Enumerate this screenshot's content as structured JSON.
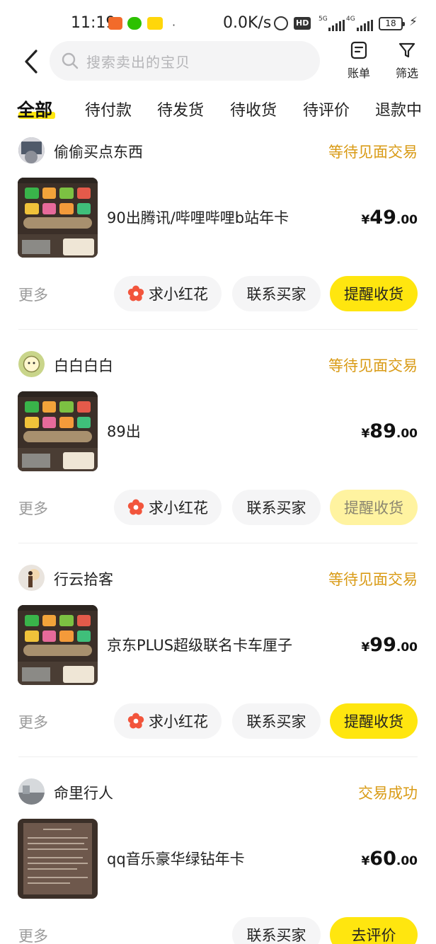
{
  "status_bar": {
    "time": "11:19",
    "dot": "·",
    "net_speed": "0.0K/s",
    "hd_badge": "HD",
    "signal_1": "5G",
    "signal_2": "4G",
    "battery": "18"
  },
  "header": {
    "search_placeholder": "搜索卖出的宝贝",
    "bill_label": "账单",
    "filter_label": "筛选"
  },
  "tabs": [
    {
      "label": "全部"
    },
    {
      "label": "待付款"
    },
    {
      "label": "待发货"
    },
    {
      "label": "待收货"
    },
    {
      "label": "待评价"
    },
    {
      "label": "退款中"
    }
  ],
  "orders": [
    {
      "buyer": "偷偷买点东西",
      "status": "等待见面交易",
      "title": "90出腾讯/哔哩哔哩b站年卡",
      "price_symbol": "¥",
      "price_int": "49",
      "price_dec": ".00",
      "more": "更多",
      "flower": "求小红花",
      "contact": "联系买家",
      "action": "提醒收货"
    },
    {
      "buyer": "白白白白",
      "status": "等待见面交易",
      "title": "89出",
      "price_symbol": "¥",
      "price_int": "89",
      "price_dec": ".00",
      "more": "更多",
      "flower": "求小红花",
      "contact": "联系买家",
      "action": "提醒收货"
    },
    {
      "buyer": "行云拾客",
      "status": "等待见面交易",
      "title": "京东PLUS超级联名卡车厘子",
      "price_symbol": "¥",
      "price_int": "99",
      "price_dec": ".00",
      "more": "更多",
      "flower": "求小红花",
      "contact": "联系买家",
      "action": "提醒收货"
    },
    {
      "buyer": "命里行人",
      "status": "交易成功",
      "title": "qq音乐豪华绿钻年卡",
      "price_symbol": "¥",
      "price_int": "60",
      "price_dec": ".00",
      "more": "更多",
      "contact": "联系买家",
      "action": "去评价"
    }
  ],
  "colors": {
    "accent_yellow": "#ffe60f",
    "status_orange": "#d99b16"
  }
}
